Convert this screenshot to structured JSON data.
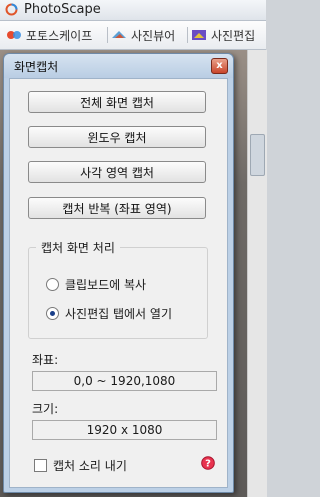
{
  "app": {
    "title": "PhotoScape",
    "tabs": [
      "포토스케이프",
      "사진뷰어",
      "사진편집"
    ]
  },
  "dialog": {
    "title": "화면캡처",
    "close_label": "x",
    "buttons": {
      "full": "전체 화면 캡처",
      "window": "윈도우 캡처",
      "region": "사각 영역 캡처",
      "repeat": "캡처 반복 (좌표 영역)"
    },
    "processing": {
      "label": "캡처 화면 처리",
      "options": [
        {
          "label": "클립보드에 복사",
          "checked": false
        },
        {
          "label": "사진편집 탭에서 열기",
          "checked": true
        }
      ]
    },
    "coords": {
      "label": "좌표:",
      "value": "0,0 ~ 1920,1080"
    },
    "size": {
      "label": "크기:",
      "value": "1920 x 1080"
    },
    "sound": {
      "label": "캡처 소리 내기",
      "checked": false
    }
  }
}
